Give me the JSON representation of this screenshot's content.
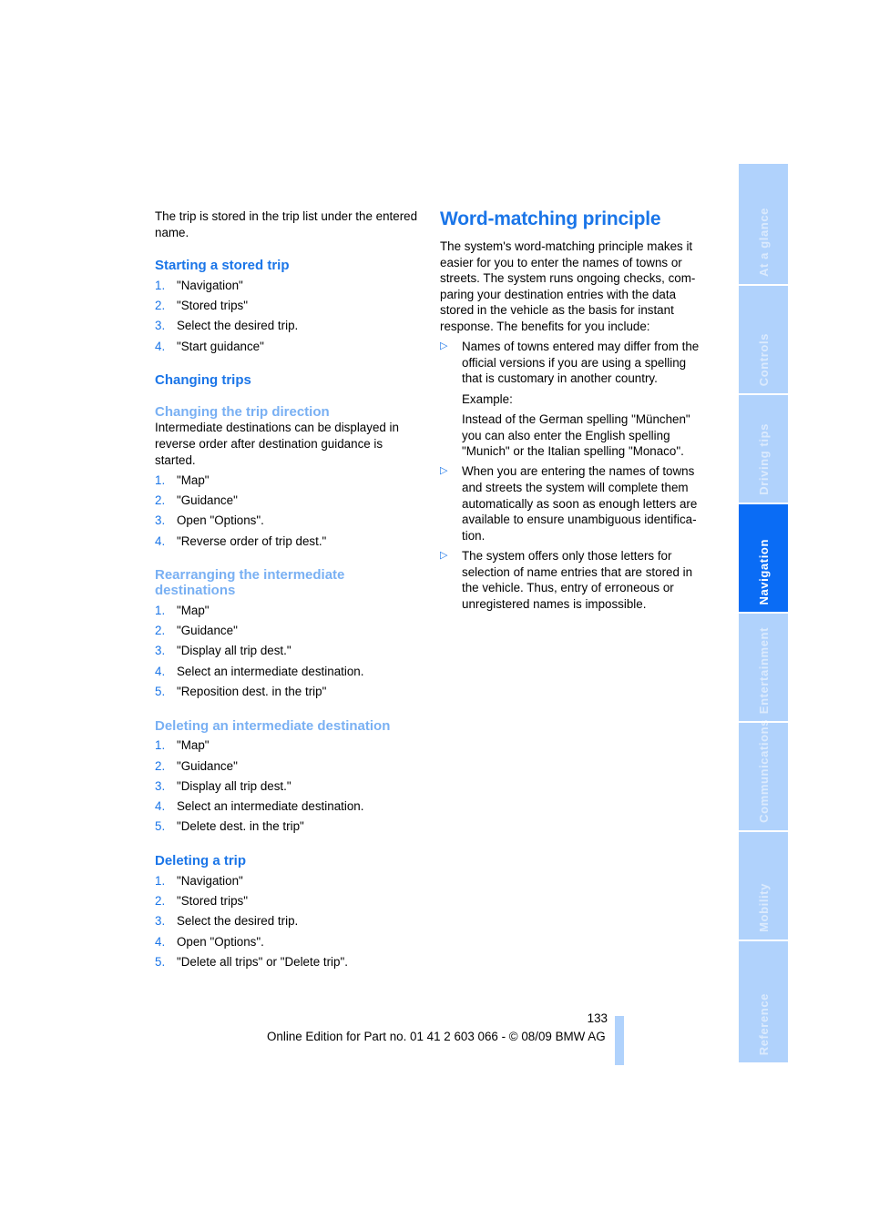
{
  "colors": {
    "accent": "#1a75e8",
    "subheading": "#79b0f3",
    "tab": "#b0d2fc",
    "tab_active": "#0a6cf5"
  },
  "left": {
    "intro": "The trip is stored in the trip list under the entered name.",
    "starting": {
      "title": "Starting a stored trip",
      "steps": [
        {
          "n": "1.",
          "t": "\"Navigation\""
        },
        {
          "n": "2.",
          "t": "\"Stored trips\""
        },
        {
          "n": "3.",
          "t": "Select the desired trip."
        },
        {
          "n": "4.",
          "t": "\"Start guidance\""
        }
      ]
    },
    "changing": {
      "title": "Changing trips"
    },
    "direction": {
      "title": "Changing the trip direction",
      "text": "Intermediate destinations can be displayed in reverse order after destination guidance is started.",
      "steps": [
        {
          "n": "1.",
          "t": "\"Map\""
        },
        {
          "n": "2.",
          "t": "\"Guidance\""
        },
        {
          "n": "3.",
          "t": "Open \"Options\"."
        },
        {
          "n": "4.",
          "t": "\"Reverse order of trip dest.\""
        }
      ]
    },
    "rearranging": {
      "title": "Rearranging the intermediate destinations",
      "steps": [
        {
          "n": "1.",
          "t": "\"Map\""
        },
        {
          "n": "2.",
          "t": "\"Guidance\""
        },
        {
          "n": "3.",
          "t": "\"Display all trip dest.\""
        },
        {
          "n": "4.",
          "t": "Select an intermediate destination."
        },
        {
          "n": "5.",
          "t": "\"Reposition dest. in the trip\""
        }
      ]
    },
    "deleting_dest": {
      "title": "Deleting an intermediate destination",
      "steps": [
        {
          "n": "1.",
          "t": "\"Map\""
        },
        {
          "n": "2.",
          "t": "\"Guidance\""
        },
        {
          "n": "3.",
          "t": "\"Display all trip dest.\""
        },
        {
          "n": "4.",
          "t": "Select an intermediate destination."
        },
        {
          "n": "5.",
          "t": "\"Delete dest. in the trip\""
        }
      ]
    },
    "deleting_trip": {
      "title": "Deleting a trip",
      "steps": [
        {
          "n": "1.",
          "t": "\"Navigation\""
        },
        {
          "n": "2.",
          "t": "\"Stored trips\""
        },
        {
          "n": "3.",
          "t": "Select the desired trip."
        },
        {
          "n": "4.",
          "t": "Open \"Options\"."
        },
        {
          "n": "5.",
          "t": "\"Delete all trips\" or \"Delete trip\"."
        }
      ]
    }
  },
  "right": {
    "title": "Word-matching principle",
    "intro": "The system's word-matching principle makes it easier for you to enter the names of towns or streets. The system runs ongoing checks, com-paring your destination entries with the data stored in the vehicle as the basis for instant response. The benefits for you include:",
    "bullet_icon": "▷",
    "bullets": [
      {
        "text": "Names of towns entered may differ from the official versions if you are using a spelling that is customary in another country.",
        "example_label": "Example:",
        "example_text": "Instead of the German spelling \"München\" you can also enter the English spelling \"Munich\" or the Italian spelling \"Monaco\"."
      },
      {
        "text": "When you are entering the names of towns and streets the system will complete them automatically as soon as enough letters are available to ensure unambiguous identifica-tion."
      },
      {
        "text": "The system offers only those letters for selection of name entries that are stored in the vehicle. Thus, entry of erroneous or unregistered names is impossible."
      }
    ]
  },
  "sidebar": {
    "tabs": [
      {
        "label": "At a glance",
        "active": false
      },
      {
        "label": "Controls",
        "active": false
      },
      {
        "label": "Driving tips",
        "active": false
      },
      {
        "label": "Navigation",
        "active": true
      },
      {
        "label": "Entertainment",
        "active": false
      },
      {
        "label": "Communications",
        "active": false
      },
      {
        "label": "Mobility",
        "active": false
      },
      {
        "label": "Reference",
        "active": false
      }
    ]
  },
  "footer": {
    "page_number": "133",
    "edition": "Online Edition for Part no. 01 41 2 603 066 - © 08/09 BMW AG"
  }
}
